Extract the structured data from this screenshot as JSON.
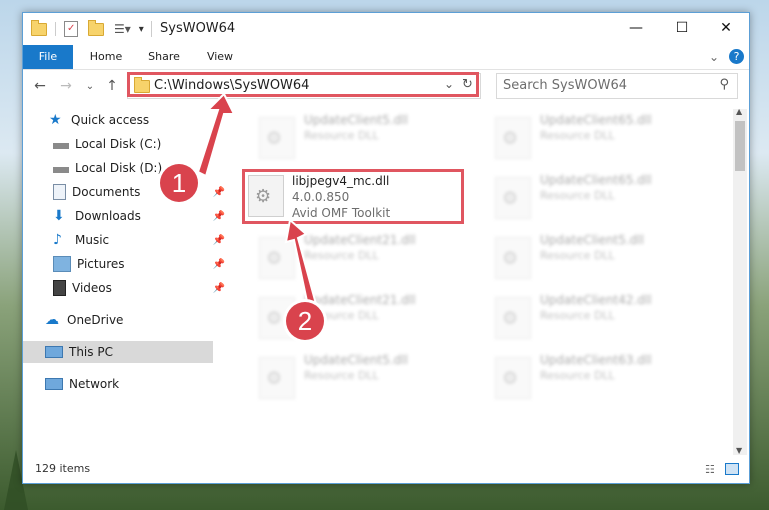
{
  "window": {
    "title": "SysWOW64"
  },
  "ribbon": {
    "tabs": [
      "File",
      "Home",
      "Share",
      "View"
    ]
  },
  "address": {
    "path": "C:\\Windows\\SysWOW64",
    "search_placeholder": "Search SysWOW64"
  },
  "sidebar": {
    "items": [
      {
        "label": "Quick access",
        "icon": "star-icon"
      },
      {
        "label": "Local Disk (C:)",
        "icon": "drive-icon",
        "pinned": true
      },
      {
        "label": "Local Disk (D:)",
        "icon": "drive-icon",
        "pinned": true
      },
      {
        "label": "Documents",
        "icon": "documents-icon",
        "pinned": true
      },
      {
        "label": "Downloads",
        "icon": "downloads-icon",
        "pinned": true
      },
      {
        "label": "Music",
        "icon": "music-icon",
        "pinned": true
      },
      {
        "label": "Pictures",
        "icon": "pictures-icon",
        "pinned": true
      },
      {
        "label": "Videos",
        "icon": "videos-icon",
        "pinned": true
      },
      {
        "label": "OneDrive",
        "icon": "cloud-icon"
      },
      {
        "label": "This PC",
        "icon": "pc-icon",
        "selected": true
      },
      {
        "label": "Network",
        "icon": "network-icon"
      }
    ]
  },
  "files": {
    "highlighted": {
      "name": "libjpegv4_mc.dll",
      "version": "4.0.0.850",
      "company": "Avid OMF Toolkit"
    },
    "background": [
      {
        "name": "UpdateClient5.dll",
        "desc": "Resource DLL"
      },
      {
        "name": "UpdateClient65.dll",
        "desc": "Resource DLL"
      },
      {
        "name": "UpdateClient65.dll",
        "desc": "Resource DLL"
      },
      {
        "name": "UpdateClient21.dll",
        "desc": "Resource DLL"
      },
      {
        "name": "UpdateClient5.dll",
        "desc": "Resource DLL"
      },
      {
        "name": "UpdateClient21.dll",
        "desc": "Resource DLL"
      },
      {
        "name": "UpdateClient42.dll",
        "desc": "Resource DLL"
      },
      {
        "name": "UpdateClient5.dll",
        "desc": "Resource DLL"
      },
      {
        "name": "UpdateClient63.dll",
        "desc": "Resource DLL"
      }
    ]
  },
  "status": {
    "item_count": "129 items"
  },
  "annotations": {
    "step1": "1",
    "step2": "2"
  },
  "colors": {
    "accent": "#1979ca",
    "highlight": "#e05660",
    "badge": "#d9434d"
  }
}
